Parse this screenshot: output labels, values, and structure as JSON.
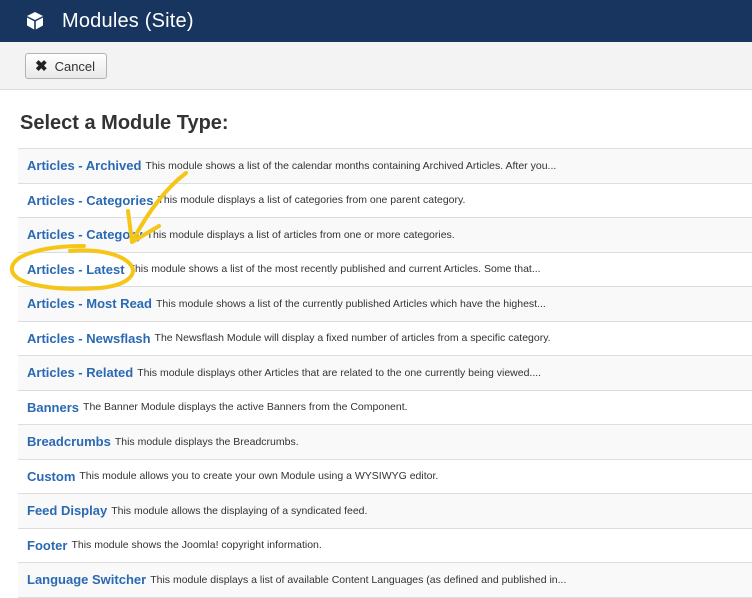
{
  "header": {
    "title": "Modules (Site)",
    "icon": "cube-icon",
    "background": "#17355f"
  },
  "toolbar": {
    "cancel_label": "Cancel",
    "cancel_icon": "close-icon"
  },
  "main": {
    "heading": "Select a Module Type:",
    "modules": [
      {
        "name": "Articles - Archived",
        "description": "This module shows a list of the calendar months containing Archived Articles. After you..."
      },
      {
        "name": "Articles - Categories",
        "description": "This module displays a list of categories from one parent category."
      },
      {
        "name": "Articles - Category",
        "description": "This module displays a list of articles from one or more categories."
      },
      {
        "name": "Articles - Latest",
        "description": "This module shows a list of the most recently published and current Articles. Some that..."
      },
      {
        "name": "Articles - Most Read",
        "description": "This module shows a list of the currently published Articles which have the highest..."
      },
      {
        "name": "Articles - Newsflash",
        "description": "The Newsflash Module will display a fixed number of articles from a specific category."
      },
      {
        "name": "Articles - Related",
        "description": "This module displays other Articles that are related to the one currently being viewed...."
      },
      {
        "name": "Banners",
        "description": "The Banner Module displays the active Banners from the Component."
      },
      {
        "name": "Breadcrumbs",
        "description": "This module displays the Breadcrumbs."
      },
      {
        "name": "Custom",
        "description": "This module allows you to create your own Module using a WYSIWYG editor."
      },
      {
        "name": "Feed Display",
        "description": "This module allows the displaying of a syndicated feed."
      },
      {
        "name": "Footer",
        "description": "This module shows the Joomla! copyright information."
      },
      {
        "name": "Language Switcher",
        "description": "This module displays a list of available Content Languages (as defined and published in..."
      }
    ]
  },
  "colors": {
    "link": "#2a69b3",
    "annotation": "#f5c518"
  }
}
